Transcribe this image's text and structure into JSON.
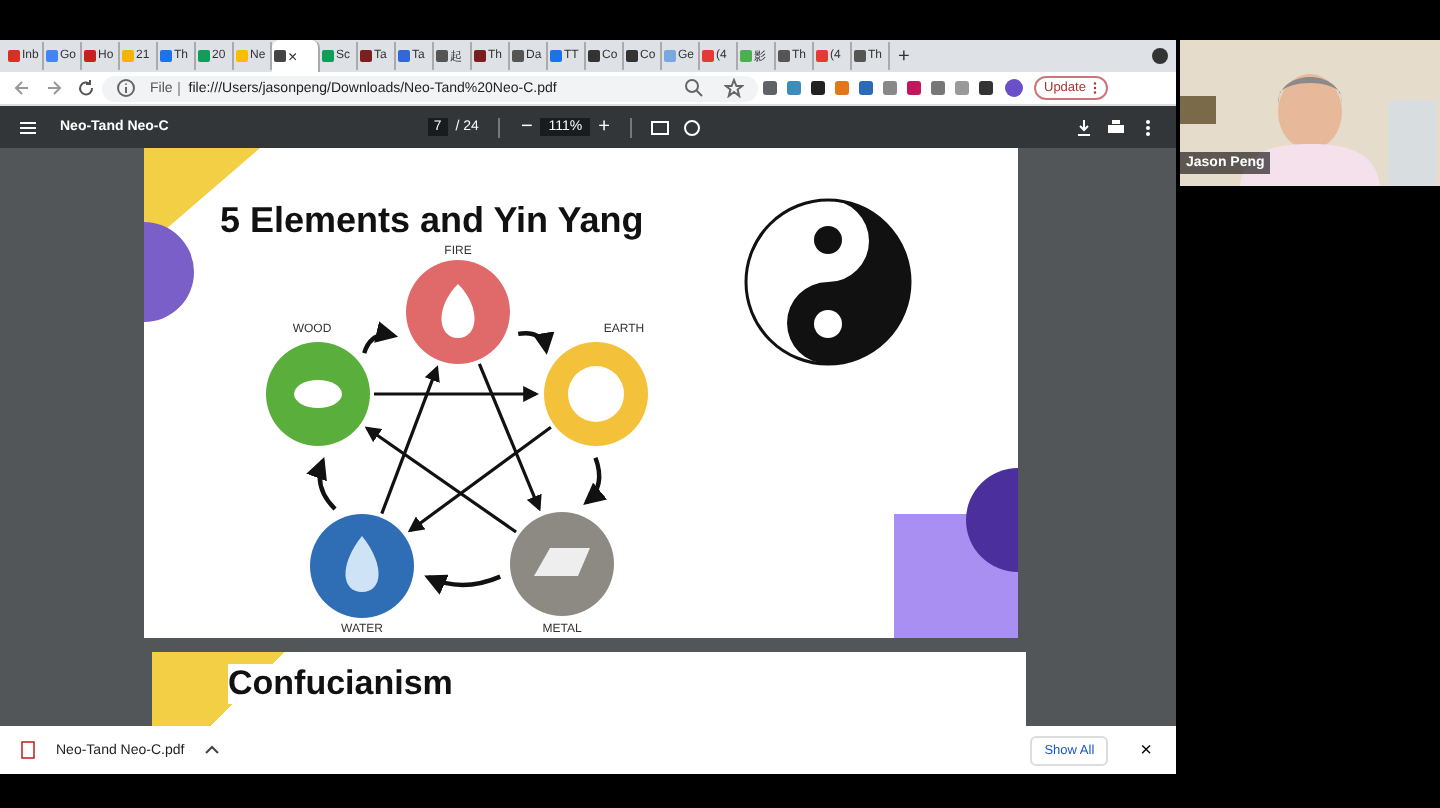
{
  "browser": {
    "tabs": [
      {
        "label": "Inb",
        "selected": false
      },
      {
        "label": "Go",
        "selected": false
      },
      {
        "label": "Ho",
        "selected": false
      },
      {
        "label": "21",
        "selected": false
      },
      {
        "label": "Th",
        "selected": false
      },
      {
        "label": "20",
        "selected": false
      },
      {
        "label": "Ne",
        "selected": false
      },
      {
        "label": "×",
        "selected": true
      },
      {
        "label": "Sc",
        "selected": false
      },
      {
        "label": "Ta",
        "selected": false
      },
      {
        "label": "Ta",
        "selected": false
      },
      {
        "label": "起",
        "selected": false
      },
      {
        "label": "Th",
        "selected": false
      },
      {
        "label": "Da",
        "selected": false
      },
      {
        "label": "TT",
        "selected": false
      },
      {
        "label": "Co",
        "selected": false
      },
      {
        "label": "Co",
        "selected": false
      },
      {
        "label": "Ge",
        "selected": false
      },
      {
        "label": "(4",
        "selected": false
      },
      {
        "label": "影",
        "selected": false
      },
      {
        "label": "Th",
        "selected": false
      },
      {
        "label": "(4",
        "selected": false
      },
      {
        "label": "Th",
        "selected": false
      }
    ],
    "new_tab": "+",
    "scheme": "File",
    "address": "file:///Users/jasonpeng/Downloads/Neo-Tand%20Neo-C.pdf",
    "update_button": "Update"
  },
  "pdf": {
    "title": "Neo-Tand Neo-C",
    "page": "7",
    "total": "/ 24",
    "minus": "−",
    "zoom": "111%",
    "plus": "+"
  },
  "slide": {
    "title": "5 Elements and Yin Yang",
    "elements": [
      {
        "label": "FIRE",
        "color": "#e06a6a"
      },
      {
        "label": "EARTH",
        "color": "#f3c13a"
      },
      {
        "label": "METAL",
        "color": "#8d8a83"
      },
      {
        "label": "WATER",
        "color": "#2f6db5"
      },
      {
        "label": "WOOD",
        "color": "#5aae3c"
      }
    ]
  },
  "next_slide": {
    "title": "Confucianism"
  },
  "download_bar": {
    "file": "Neo-Tand Neo-C.pdf",
    "show_all": "Show All",
    "close": "×"
  },
  "participant": {
    "name": "Jason Peng"
  }
}
